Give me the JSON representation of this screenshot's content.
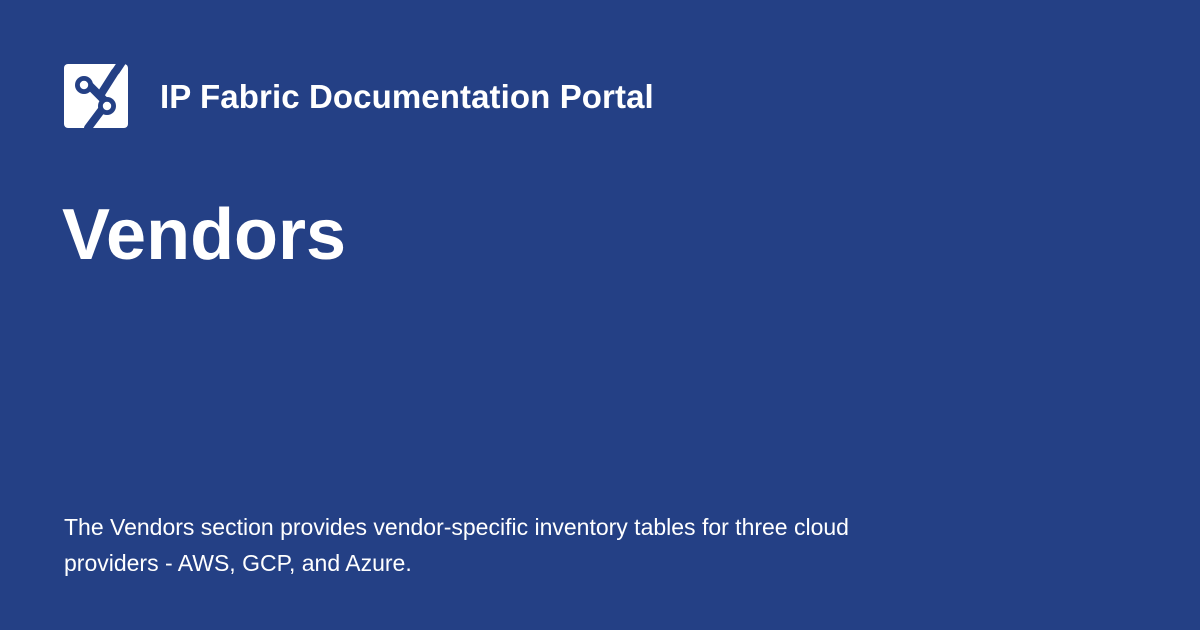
{
  "header": {
    "logo_icon": "ip-fabric-logo-icon",
    "site_title": "IP Fabric Documentation Portal"
  },
  "page": {
    "title": "Vendors",
    "description": "The Vendors section provides vendor-specific inventory tables for three cloud providers - AWS, GCP, and Azure."
  },
  "colors": {
    "background": "#244085",
    "text": "#ffffff",
    "logo_background": "#ffffff",
    "logo_mark": "#244085"
  }
}
